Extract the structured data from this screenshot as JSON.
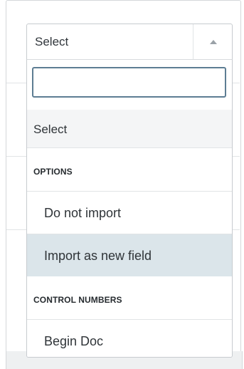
{
  "select": {
    "value": "Select"
  },
  "dropdown": {
    "search": {
      "value": "",
      "placeholder": ""
    },
    "default_option": "Select",
    "groups": [
      {
        "label": "OPTIONS",
        "items": [
          {
            "label": "Do not import",
            "active": false
          },
          {
            "label": "Import as new field",
            "active": true
          }
        ]
      },
      {
        "label": "CONTROL NUMBERS",
        "items": [
          {
            "label": "Begin Doc",
            "active": false
          }
        ]
      }
    ]
  },
  "colors": {
    "highlight": "#dbe5ea",
    "focus_border": "#5d7d93",
    "bottom_strip": "#eef0f1"
  },
  "icons": {
    "toggle": "chevron-up-icon"
  }
}
